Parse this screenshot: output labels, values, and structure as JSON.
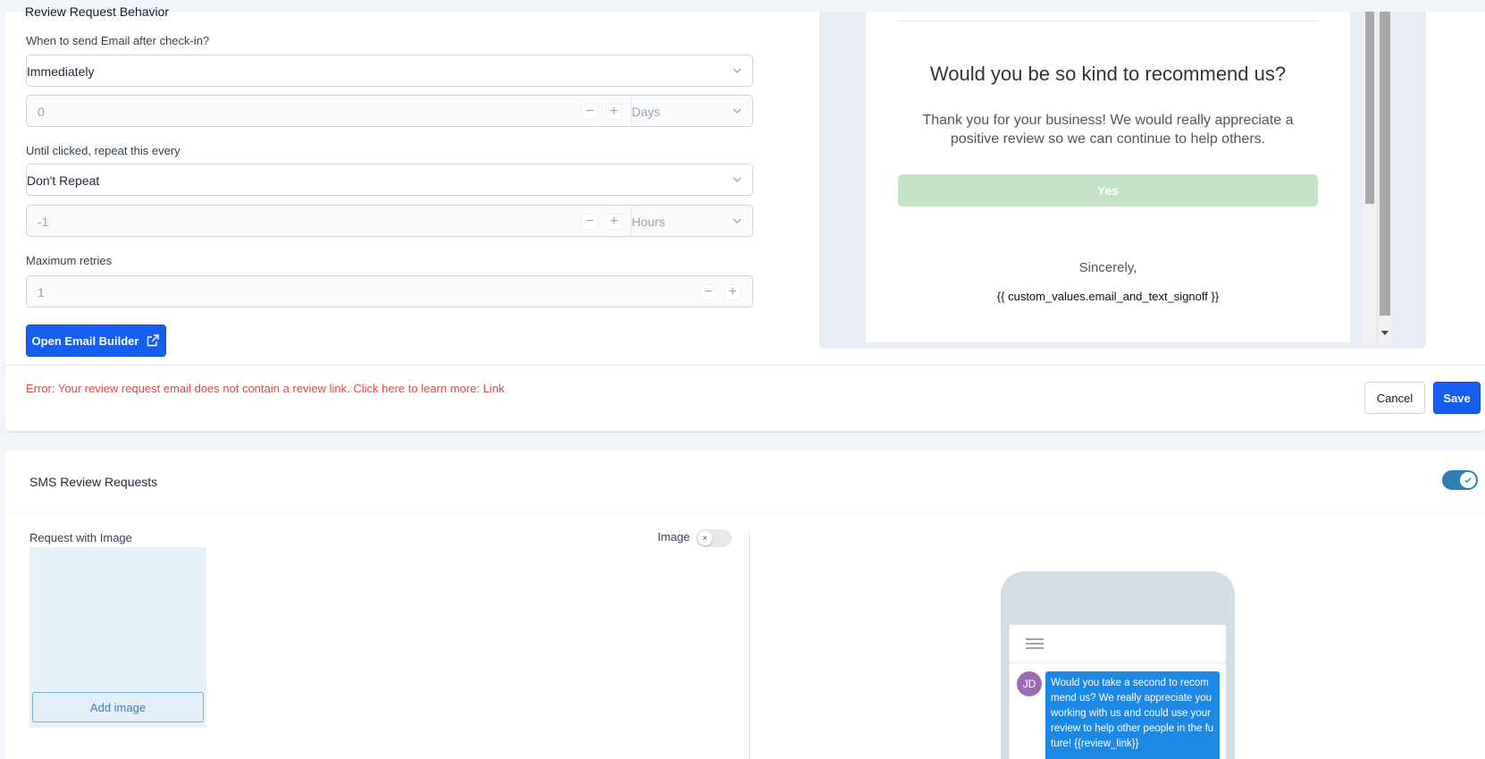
{
  "email_section": {
    "title": "Review Request Behavior",
    "when_label": "When to send Email after check-in?",
    "when_value": "Immediately",
    "delay_value": "0",
    "delay_unit": "Days",
    "repeat_label": "Until clicked, repeat this every",
    "repeat_value": "Don't Repeat",
    "repeat_interval_value": "-1",
    "repeat_unit": "Hours",
    "max_retries_label": "Maximum retries",
    "max_retries_value": "1",
    "open_builder_label": "Open Email Builder",
    "error_text": "Error: Your review request email does not contain a review link. Click here to learn more: Link",
    "cancel_label": "Cancel",
    "save_label": "Save"
  },
  "email_preview": {
    "heading": "Would you be so kind to recommend us?",
    "body": "Thank you for your business! We would really appreciate a positive review so we can continue to help others.",
    "yes_label": "Yes",
    "sincerely": "Sincerely,",
    "signoff": "{{ custom_values.email_and_text_signoff }}"
  },
  "sms_section": {
    "title": "SMS Review Requests",
    "enabled": true,
    "request_with_image_label": "Request with Image",
    "image_toggle_label": "Image",
    "image_enabled": false,
    "add_image_label": "Add image"
  },
  "phone_preview": {
    "avatar_initials": "JD",
    "message": "Would you take a second to recommend us? We really appreciate you working with us and could use your review to help other people in the future! {{review_link}}"
  },
  "colors": {
    "primary": "#155eef",
    "error": "#dc4b4b",
    "toggle_on": "#2f7db5",
    "yes_button": "#c3e3c4",
    "sms_bubble": "#1e88e5"
  }
}
